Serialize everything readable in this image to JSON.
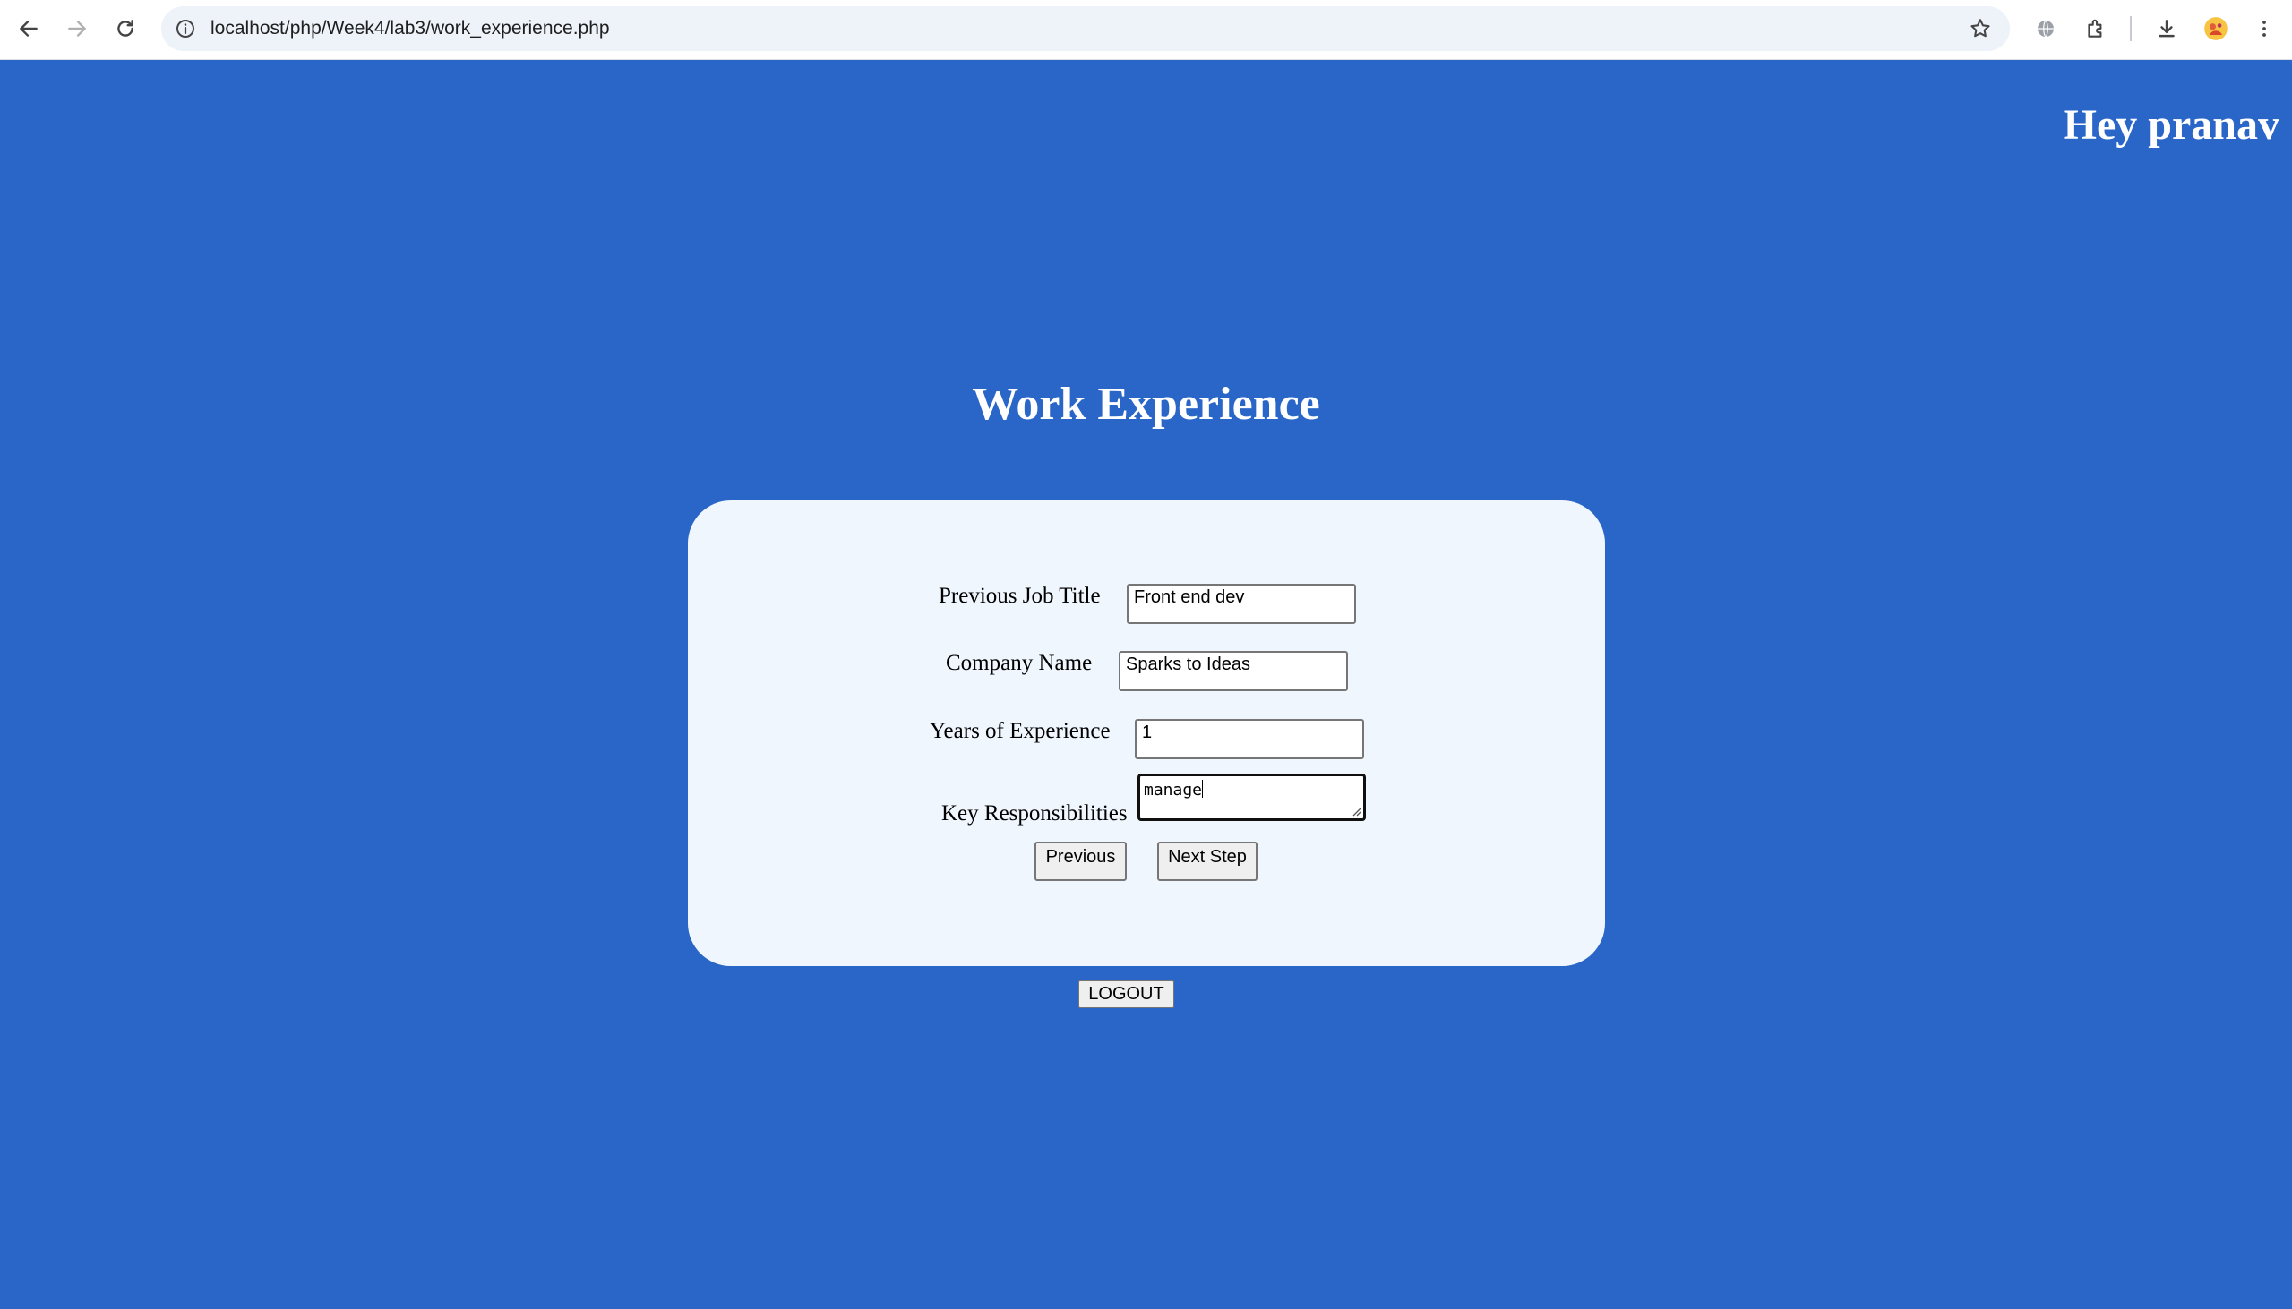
{
  "browser": {
    "url": "localhost/php/Week4/lab3/work_experience.php",
    "icons": [
      "back-arrow-icon",
      "forward-arrow-icon",
      "reload-icon",
      "site-info-icon",
      "bookmark-star-icon",
      "translate-icon",
      "extensions-icon",
      "download-icon",
      "profile-icon",
      "more-menu-icon"
    ]
  },
  "page": {
    "greeting": "Hey pranav",
    "title": "Work Experience",
    "background_color": "#2a66c8",
    "card_color": "#f0f6fe"
  },
  "form": {
    "job_title": {
      "label": "Previous Job Title",
      "value": "Front end dev"
    },
    "company": {
      "label": "Company Name",
      "value": "Sparks to Ideas"
    },
    "years": {
      "label": "Years of Experience",
      "value": "1"
    },
    "responsibilities": {
      "label": "Key Responsibilities",
      "value": "manage"
    },
    "previous_label": "Previous",
    "next_label": "Next Step"
  },
  "logout_label": "LOGOUT"
}
